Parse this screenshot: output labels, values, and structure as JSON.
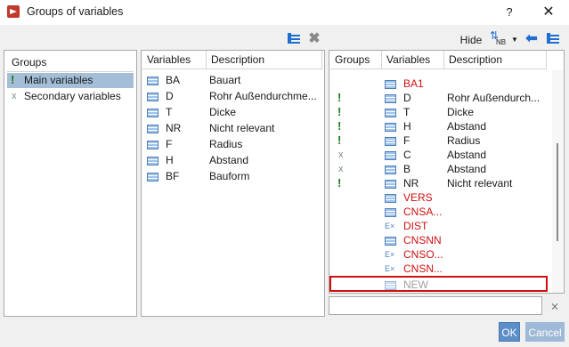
{
  "window": {
    "title": "Groups of variables",
    "help_label": "?",
    "close_label": "✕"
  },
  "groups_panel": {
    "header": "Groups",
    "items": [
      {
        "marker": "!",
        "label": "Main variables"
      },
      {
        "marker": "x",
        "label": "Secondary variables"
      }
    ]
  },
  "available_panel": {
    "columns": [
      "Variables",
      "Description"
    ],
    "rows": [
      {
        "variable": "BA",
        "description": "Bauart"
      },
      {
        "variable": "D",
        "description": "Rohr Außendurchme..."
      },
      {
        "variable": "T",
        "description": "Dicke"
      },
      {
        "variable": "NR",
        "description": "Nicht relevant"
      },
      {
        "variable": "F",
        "description": "Radius"
      },
      {
        "variable": "H",
        "description": "Abstand"
      },
      {
        "variable": "BF",
        "description": "Bauform"
      }
    ]
  },
  "toolbar_right": {
    "hide_label": "Hide",
    "nb_label": "NB"
  },
  "assigned_panel": {
    "columns": [
      "Groups",
      "Variables",
      "Description"
    ],
    "rows": [
      {
        "group": "",
        "variable": "BA1",
        "description": ""
      },
      {
        "group": "!",
        "variable": "D",
        "description": "Rohr Außendurch..."
      },
      {
        "group": "!",
        "variable": "T",
        "description": "Dicke"
      },
      {
        "group": "!",
        "variable": "H",
        "description": "Abstand"
      },
      {
        "group": "!",
        "variable": "F",
        "description": "Radius"
      },
      {
        "group": "x",
        "variable": "C",
        "description": "Abstand"
      },
      {
        "group": "x",
        "variable": "B",
        "description": "Abstand"
      },
      {
        "group": "!",
        "variable": "NR",
        "description": "Nicht relevant"
      },
      {
        "group": "",
        "variable": "VERS",
        "description": ""
      },
      {
        "group": "",
        "variable": "CNSA...",
        "description": ""
      },
      {
        "group": "",
        "variable": "DIST",
        "description": ""
      },
      {
        "group": "",
        "variable": "CNSNN",
        "description": ""
      },
      {
        "group": "",
        "variable": "CNSO...",
        "description": ""
      },
      {
        "group": "",
        "variable": "CNSN...",
        "description": ""
      },
      {
        "group": "",
        "variable": "NEW",
        "description": ""
      }
    ],
    "ex_icon_label": "E×"
  },
  "buttons": {
    "ok": "OK",
    "cancel": "Cancel"
  },
  "colors": {
    "accent": "#5c8ec8",
    "selection": "#a3bed6",
    "error_red": "#d01010",
    "highlight_border": "#d01010"
  }
}
